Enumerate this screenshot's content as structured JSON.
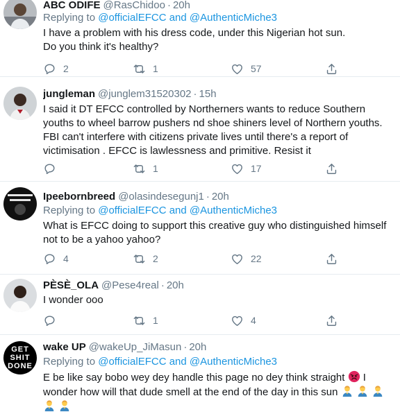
{
  "tweets": [
    {
      "name": "ABC ODIFE",
      "handle": "@RasChidoo",
      "sep": "·",
      "time": "20h",
      "replying_prefix": "Replying to",
      "mention1": "@officialEFCC",
      "and": "and",
      "mention2": "@AuthenticMiche3",
      "text": "I have a problem with his dress code, under this Nigerian hot sun.\nDo you think it's healthy?",
      "replies": "2",
      "retweets": "1",
      "likes": "57"
    },
    {
      "name": "jungleman",
      "handle": "@junglem31520302",
      "sep": "·",
      "time": "15h",
      "text": "I said it DT EFCC controlled by Northerners wants to reduce Southern youths to wheel barrow pushers nd shoe shiners level of Northern youths. FBI can't interfere with citizens private lives until there's a report of victimisation . EFCC is lawlessness and primitive. Resist it",
      "replies": "",
      "retweets": "1",
      "likes": "17"
    },
    {
      "name": "Ipeebornbreed",
      "handle": "@olasindesegunj1",
      "sep": "·",
      "time": "20h",
      "replying_prefix": "Replying to",
      "mention1": "@officialEFCC",
      "and": "and",
      "mention2": "@AuthenticMiche3",
      "text": "What is EFCC doing to support this creative guy who distinguished himself not to be a yahoo yahoo?",
      "replies": "4",
      "retweets": "2",
      "likes": "22"
    },
    {
      "name": "PÈSÈ_OLA",
      "handle": "@Pese4real",
      "sep": "·",
      "time": "20h",
      "text": "I wonder ooo",
      "replies": "",
      "retweets": "1",
      "likes": "4"
    },
    {
      "name": "wake UP",
      "handle": "@wakeUp_JiMasun",
      "sep": "·",
      "time": "20h",
      "replying_prefix": "Replying to",
      "mention1": "@officialEFCC",
      "and": "and",
      "mention2": "@AuthenticMiche3",
      "text_line1": "E be like say bobo wey dey handle this page no dey think straight",
      "text_line1_end": "I",
      "text_line2": "wonder how will that dude smell at the end of the day in this sun",
      "avatar_text": [
        "GET",
        "SHIT",
        "DONE"
      ]
    }
  ],
  "icons": {
    "reply": "reply-icon",
    "retweet": "retweet-icon",
    "like": "heart-icon",
    "share": "share-icon"
  },
  "colors": {
    "link": "#1b95e0",
    "muted": "#657786",
    "text": "#14171a",
    "divider": "#e6ecf0"
  }
}
